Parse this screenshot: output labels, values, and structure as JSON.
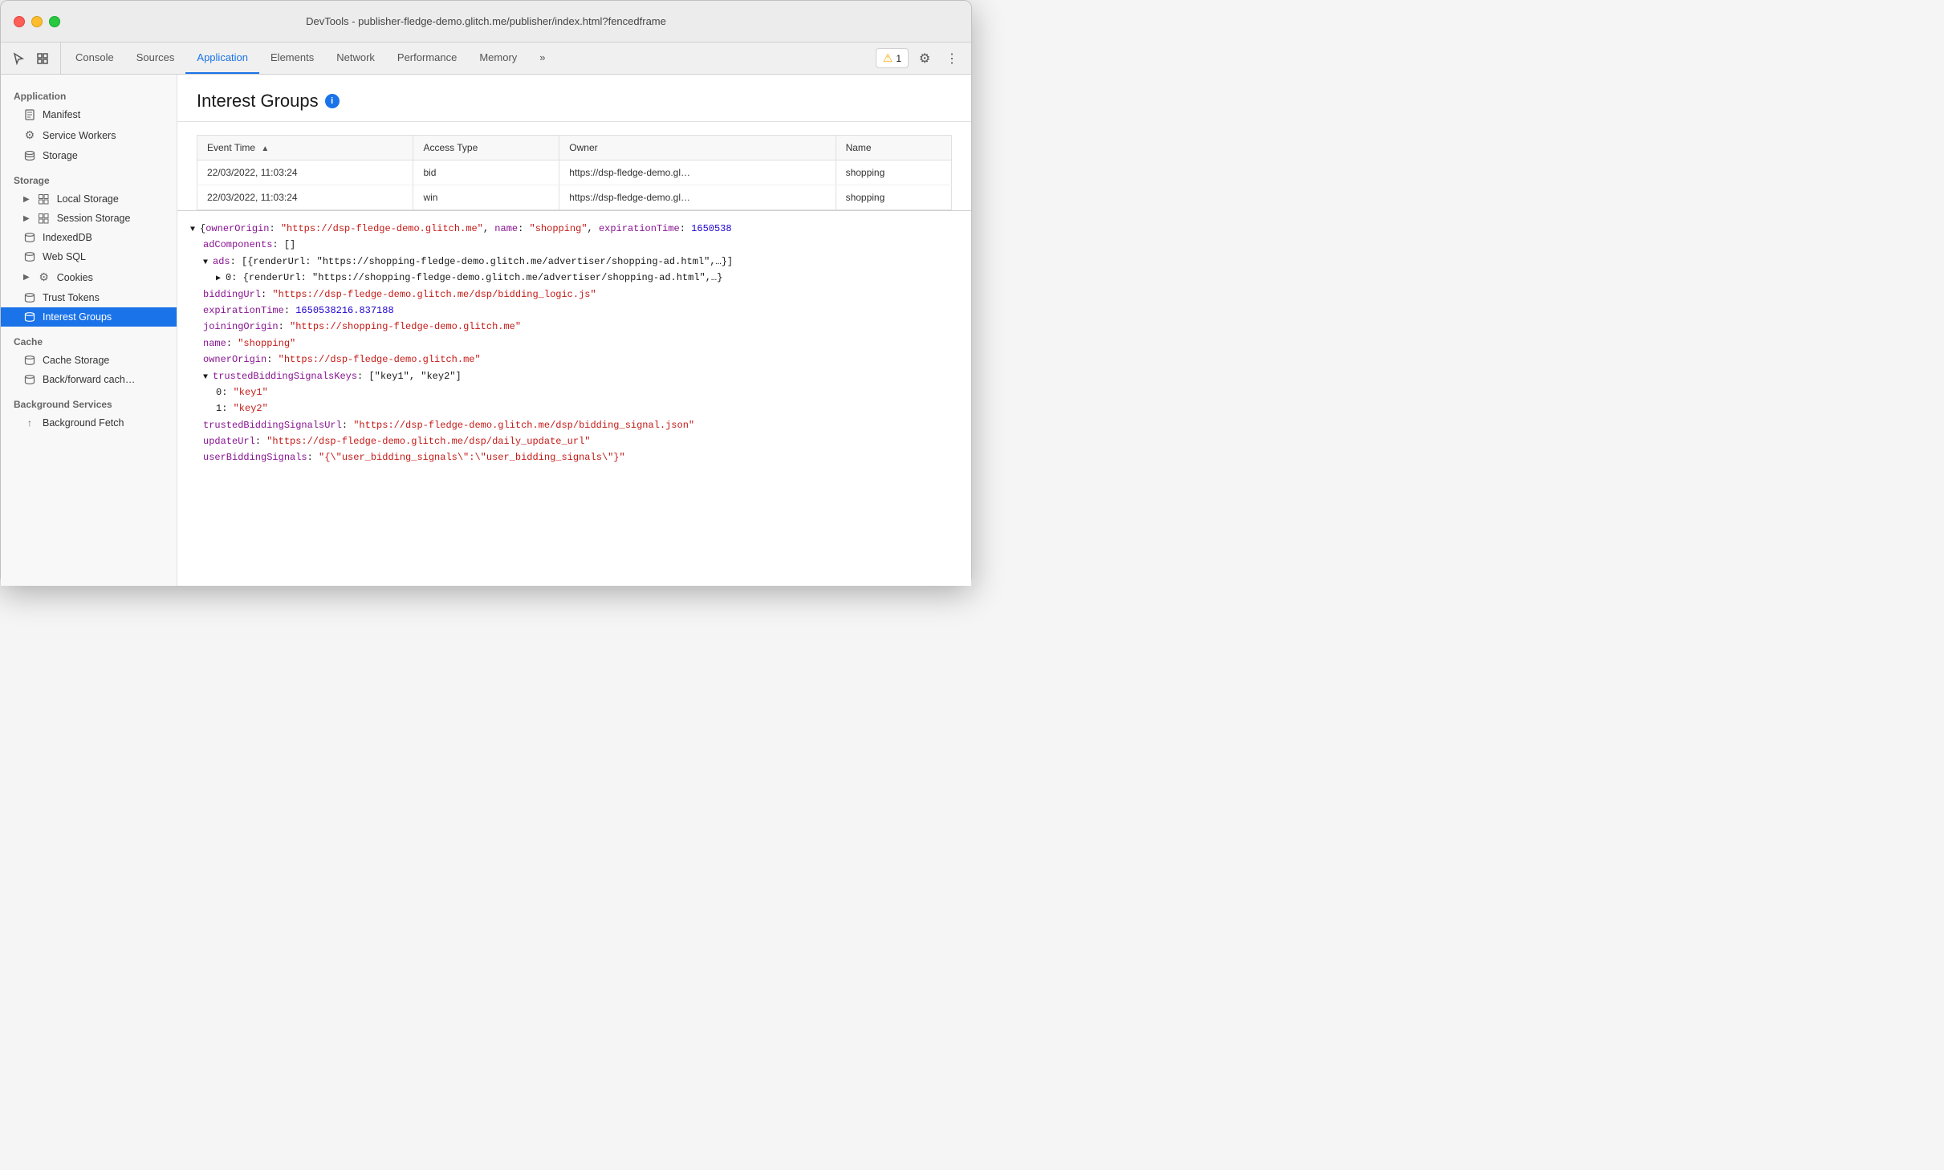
{
  "titlebar": {
    "title": "DevTools - publisher-fledge-demo.glitch.me/publisher/index.html?fencedframe"
  },
  "toolbar": {
    "tabs": [
      {
        "id": "console",
        "label": "Console",
        "active": false
      },
      {
        "id": "sources",
        "label": "Sources",
        "active": false
      },
      {
        "id": "application",
        "label": "Application",
        "active": true
      },
      {
        "id": "elements",
        "label": "Elements",
        "active": false
      },
      {
        "id": "network",
        "label": "Network",
        "active": false
      },
      {
        "id": "performance",
        "label": "Performance",
        "active": false
      },
      {
        "id": "memory",
        "label": "Memory",
        "active": false
      },
      {
        "id": "more",
        "label": "»",
        "active": false
      }
    ],
    "warning_count": "1",
    "warning_label": "1"
  },
  "sidebar": {
    "sections": [
      {
        "label": "Application",
        "items": [
          {
            "id": "manifest",
            "label": "Manifest",
            "icon": "📄",
            "indent": 1
          },
          {
            "id": "service-workers",
            "label": "Service Workers",
            "icon": "⚙️",
            "indent": 1
          },
          {
            "id": "storage",
            "label": "Storage",
            "icon": "🗄️",
            "indent": 1
          }
        ]
      },
      {
        "label": "Storage",
        "items": [
          {
            "id": "local-storage",
            "label": "Local Storage",
            "icon": "▶",
            "isArrow": true,
            "iconType": "grid",
            "indent": 1
          },
          {
            "id": "session-storage",
            "label": "Session Storage",
            "icon": "▶",
            "isArrow": true,
            "iconType": "grid",
            "indent": 1
          },
          {
            "id": "indexeddb",
            "label": "IndexedDB",
            "icon": "db",
            "indent": 1
          },
          {
            "id": "web-sql",
            "label": "Web SQL",
            "icon": "db",
            "indent": 1
          },
          {
            "id": "cookies",
            "label": "Cookies",
            "icon": "▶",
            "isArrow": true,
            "iconType": "cookie",
            "indent": 1
          },
          {
            "id": "trust-tokens",
            "label": "Trust Tokens",
            "icon": "db",
            "indent": 1
          },
          {
            "id": "interest-groups",
            "label": "Interest Groups",
            "icon": "db",
            "indent": 1,
            "active": true
          }
        ]
      },
      {
        "label": "Cache",
        "items": [
          {
            "id": "cache-storage",
            "label": "Cache Storage",
            "icon": "db",
            "indent": 1
          },
          {
            "id": "back-forward-cache",
            "label": "Back/forward cach…",
            "icon": "db",
            "indent": 1
          }
        ]
      },
      {
        "label": "Background Services",
        "items": [
          {
            "id": "background-fetch",
            "label": "Background Fetch",
            "icon": "↑",
            "indent": 1
          }
        ]
      }
    ]
  },
  "main": {
    "page_title": "Interest Groups",
    "table": {
      "columns": [
        {
          "id": "event-time",
          "label": "Event Time",
          "sortable": true
        },
        {
          "id": "access-type",
          "label": "Access Type"
        },
        {
          "id": "owner",
          "label": "Owner"
        },
        {
          "id": "name",
          "label": "Name"
        }
      ],
      "rows": [
        {
          "event_time": "22/03/2022, 11:03:24",
          "access_type": "bid",
          "owner": "https://dsp-fledge-demo.gl…",
          "name": "shopping"
        },
        {
          "event_time": "22/03/2022, 11:03:24",
          "access_type": "win",
          "owner": "https://dsp-fledge-demo.gl…",
          "name": "shopping"
        }
      ]
    },
    "detail": {
      "lines": [
        {
          "type": "toggle",
          "open": true,
          "indent": 0,
          "key": "",
          "content": "{ownerOrigin: \"https://dsp-fledge-demo.glitch.me\", name: \"shopping\", expirationTime: 1650538",
          "keyColor": false
        },
        {
          "type": "plain",
          "indent": 1,
          "key": "adComponents",
          "colon": ": ",
          "value": "[]",
          "keyClass": "key-color",
          "valueClass": ""
        },
        {
          "type": "toggle",
          "open": true,
          "indent": 1,
          "key": "ads",
          "colon": ": ",
          "value": "[{renderUrl: \"https://shopping-fledge-demo.glitch.me/advertiser/shopping-ad.html\",…}]",
          "keyClass": "key-color",
          "valueClass": ""
        },
        {
          "type": "toggle",
          "open": false,
          "indent": 2,
          "key": "▶ 0",
          "colon": ": ",
          "value": "{renderUrl: \"https://shopping-fledge-demo.glitch.me/advertiser/shopping-ad.html\",…}",
          "keyClass": "",
          "valueClass": ""
        },
        {
          "type": "plain",
          "indent": 1,
          "key": "biddingUrl",
          "colon": ": ",
          "value": "\"https://dsp-fledge-demo.glitch.me/dsp/bidding_logic.js\"",
          "keyClass": "key-color",
          "valueClass": "str-color"
        },
        {
          "type": "plain",
          "indent": 1,
          "key": "expirationTime",
          "colon": ": ",
          "value": "1650538216.837188",
          "keyClass": "key-color",
          "valueClass": "num-color"
        },
        {
          "type": "plain",
          "indent": 1,
          "key": "joiningOrigin",
          "colon": ": ",
          "value": "\"https://shopping-fledge-demo.glitch.me\"",
          "keyClass": "key-color",
          "valueClass": "str-color"
        },
        {
          "type": "plain",
          "indent": 1,
          "key": "name",
          "colon": ": ",
          "value": "\"shopping\"",
          "keyClass": "key-color",
          "valueClass": "str-color"
        },
        {
          "type": "plain",
          "indent": 1,
          "key": "ownerOrigin",
          "colon": ": ",
          "value": "\"https://dsp-fledge-demo.glitch.me\"",
          "keyClass": "key-color",
          "valueClass": "str-color"
        },
        {
          "type": "toggle",
          "open": true,
          "indent": 1,
          "key": "trustedBiddingSignalsKeys",
          "colon": ": ",
          "value": "[\"key1\", \"key2\"]",
          "keyClass": "key-color",
          "valueClass": ""
        },
        {
          "type": "plain",
          "indent": 2,
          "key": "0",
          "colon": ": ",
          "value": "\"key1\"",
          "keyClass": "",
          "valueClass": "str-color"
        },
        {
          "type": "plain",
          "indent": 2,
          "key": "1",
          "colon": ": ",
          "value": "\"key2\"",
          "keyClass": "",
          "valueClass": "str-color"
        },
        {
          "type": "plain",
          "indent": 1,
          "key": "trustedBiddingSignalsUrl",
          "colon": ": ",
          "value": "\"https://dsp-fledge-demo.glitch.me/dsp/bidding_signal.json\"",
          "keyClass": "key-color",
          "valueClass": "str-color"
        },
        {
          "type": "plain",
          "indent": 1,
          "key": "updateUrl",
          "colon": ": ",
          "value": "\"https://dsp-fledge-demo.glitch.me/dsp/daily_update_url\"",
          "keyClass": "key-color",
          "valueClass": "str-color"
        },
        {
          "type": "plain",
          "indent": 1,
          "key": "userBiddingSignals",
          "colon": ": ",
          "value": "\"{\\\"user_bidding_signals\\\":\\\"user_bidding_signals\\\"}\"",
          "keyClass": "key-color",
          "valueClass": "str-color"
        }
      ]
    }
  }
}
